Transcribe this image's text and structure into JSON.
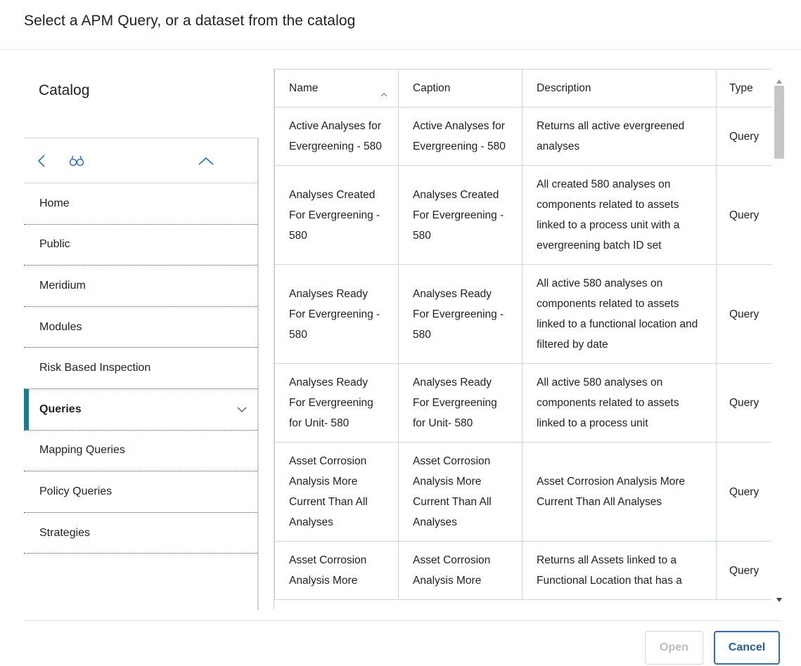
{
  "dialog": {
    "title": "Select a APM Query, or a dataset from the catalog"
  },
  "catalog": {
    "title": "Catalog",
    "toolbar_icons": [
      "chevron-left-icon",
      "binoculars-icon",
      "chevron-up-icon"
    ],
    "items": [
      {
        "label": "Home",
        "active": false
      },
      {
        "label": "Public",
        "active": false
      },
      {
        "label": "Meridium",
        "active": false
      },
      {
        "label": "Modules",
        "active": false
      },
      {
        "label": "Risk Based Inspection",
        "active": false
      },
      {
        "label": "Queries",
        "active": true
      },
      {
        "label": "Mapping Queries",
        "active": false
      },
      {
        "label": "Policy Queries",
        "active": false
      },
      {
        "label": "Strategies",
        "active": false
      }
    ],
    "accent_color": "#1d7a8c"
  },
  "table": {
    "columns": [
      "Name",
      "Caption",
      "Description",
      "Type"
    ],
    "sort_column": "Name",
    "sort_direction": "ascending",
    "rows": [
      {
        "name": "Active Analyses for Evergreening - 580",
        "caption": "Active Analyses for Evergreening - 580",
        "description": "Returns all active evergreened analyses",
        "type": "Query"
      },
      {
        "name": "Analyses Created For Evergreening - 580",
        "caption": "Analyses Created For Evergreening - 580",
        "description": "All created 580 analyses on components related to assets linked to a process unit with a evergreening batch ID set",
        "type": "Query"
      },
      {
        "name": "Analyses Ready For Evergreening - 580",
        "caption": "Analyses Ready For Evergreening - 580",
        "description": "All active 580 analyses on components related to assets linked to a functional location and filtered by date",
        "type": "Query"
      },
      {
        "name": "Analyses Ready For Evergreening for Unit- 580",
        "caption": "Analyses Ready For Evergreening for Unit- 580",
        "description": "All active 580 analyses on components related to assets linked to a process unit",
        "type": "Query"
      },
      {
        "name": "Asset Corrosion Analysis More Current Than All Analyses",
        "caption": "Asset Corrosion Analysis More Current Than All Analyses",
        "description": "Asset Corrosion Analysis More Current Than All Analyses",
        "type": "Query"
      },
      {
        "name": "Asset Corrosion Analysis More",
        "caption": "Asset Corrosion Analysis More",
        "description": "Returns all Assets linked to a Functional Location that has a",
        "type": "Query"
      }
    ]
  },
  "footer": {
    "open_label": "Open",
    "cancel_label": "Cancel",
    "primary_color": "#2f6fb8"
  }
}
